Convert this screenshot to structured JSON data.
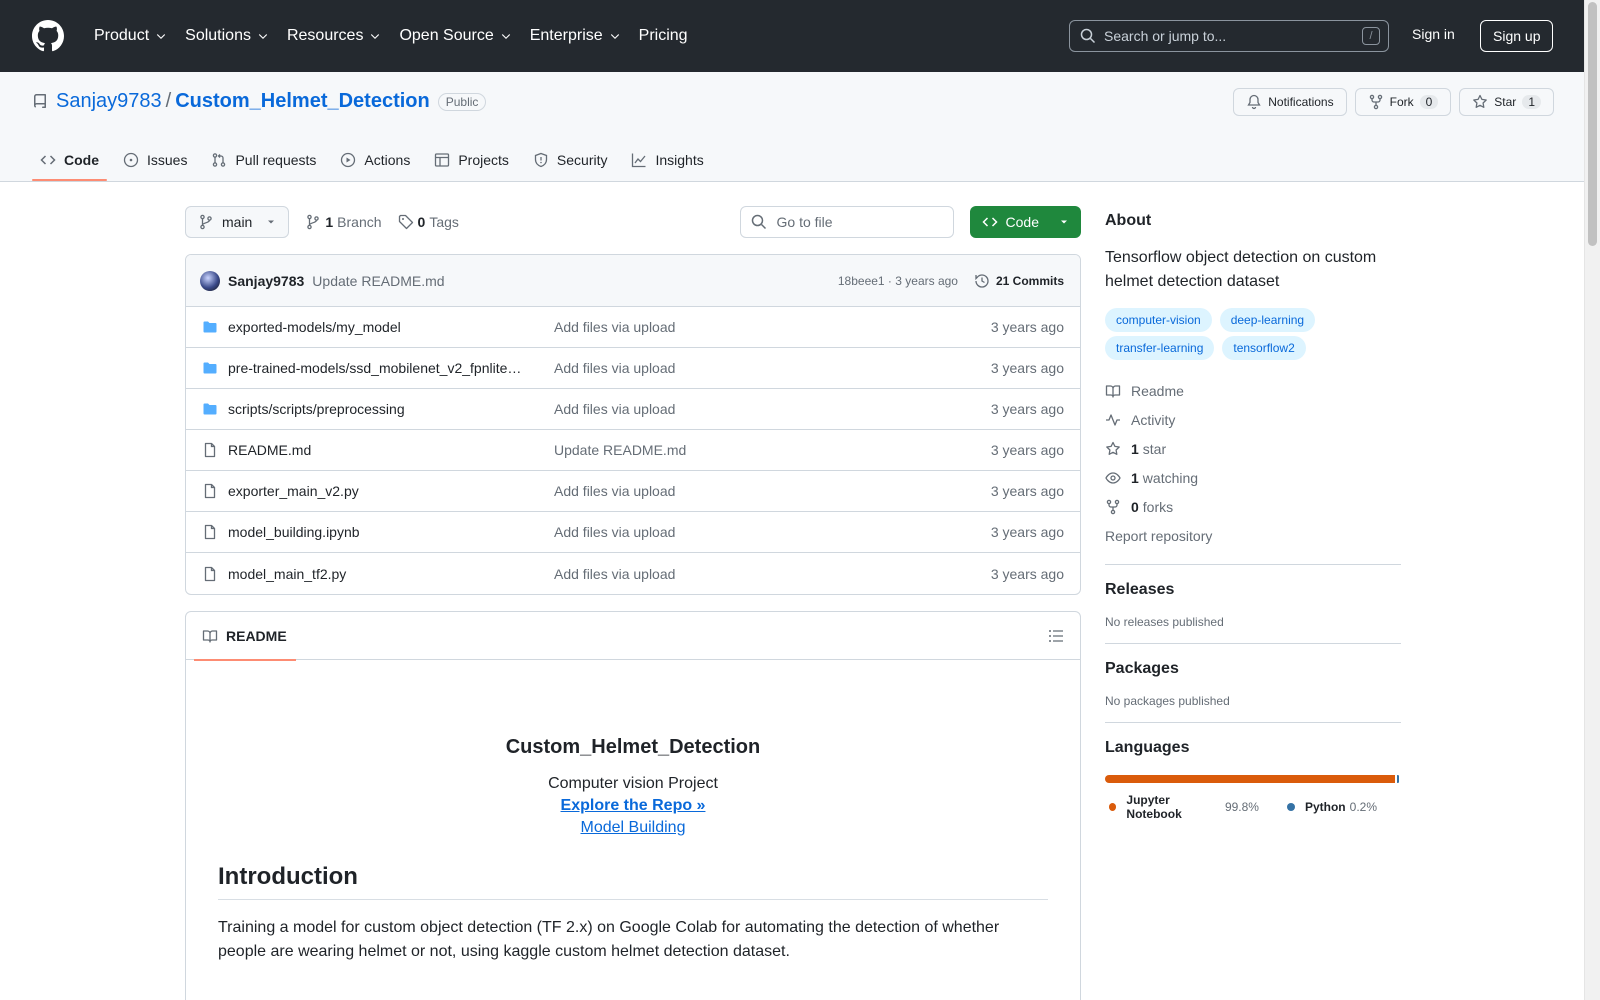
{
  "header": {
    "nav": [
      {
        "label": "Product",
        "dropdown": true
      },
      {
        "label": "Solutions",
        "dropdown": true
      },
      {
        "label": "Resources",
        "dropdown": true
      },
      {
        "label": "Open Source",
        "dropdown": true
      },
      {
        "label": "Enterprise",
        "dropdown": true
      },
      {
        "label": "Pricing",
        "dropdown": false
      }
    ],
    "search_placeholder": "Search or jump to...",
    "search_shortcut": "/",
    "sign_in": "Sign in",
    "sign_up": "Sign up"
  },
  "repo": {
    "owner": "Sanjay9783",
    "separator": "/",
    "name": "Custom_Helmet_Detection",
    "visibility": "Public",
    "notifications_label": "Notifications",
    "fork_label": "Fork",
    "fork_count": "0",
    "star_label": "Star",
    "star_count": "1"
  },
  "tabs": [
    {
      "label": "Code",
      "icon": "code-icon",
      "active": true
    },
    {
      "label": "Issues",
      "icon": "issue-icon",
      "active": false
    },
    {
      "label": "Pull requests",
      "icon": "pull-request-icon",
      "active": false
    },
    {
      "label": "Actions",
      "icon": "play-icon",
      "active": false
    },
    {
      "label": "Projects",
      "icon": "table-icon",
      "active": false
    },
    {
      "label": "Security",
      "icon": "shield-icon",
      "active": false
    },
    {
      "label": "Insights",
      "icon": "graph-icon",
      "active": false
    }
  ],
  "toolbar": {
    "branch": "main",
    "branch_count": "1",
    "branch_label": "Branch",
    "tag_count": "0",
    "tag_label": "Tags",
    "goto_placeholder": "Go to file",
    "code_button": "Code"
  },
  "latest_commit": {
    "author": "Sanjay9783",
    "message": "Update README.md",
    "meta": "18beee1 · 3 years ago",
    "commits": "21 Commits"
  },
  "files": [
    {
      "name": "exported-models/my_model",
      "type": "folder",
      "message": "Add files via upload",
      "date": "3 years ago"
    },
    {
      "name": "pre-trained-models/ssd_mobilenet_v2_fpnlite…",
      "type": "folder",
      "message": "Add files via upload",
      "date": "3 years ago"
    },
    {
      "name": "scripts/scripts/preprocessing",
      "type": "folder",
      "message": "Add files via upload",
      "date": "3 years ago"
    },
    {
      "name": "README.md",
      "type": "file",
      "message": "Update README.md",
      "date": "3 years ago"
    },
    {
      "name": "exporter_main_v2.py",
      "type": "file",
      "message": "Add files via upload",
      "date": "3 years ago"
    },
    {
      "name": "model_building.ipynb",
      "type": "file",
      "message": "Add files via upload",
      "date": "3 years ago"
    },
    {
      "name": "model_main_tf2.py",
      "type": "file",
      "message": "Add files via upload",
      "date": "3 years ago"
    }
  ],
  "readme": {
    "tab_label": "README",
    "title": "Custom_Helmet_Detection",
    "subtitle": "Computer vision Project",
    "link_explore": "Explore the Repo »",
    "link_model": "Model Building",
    "h_intro": "Introduction",
    "intro_text": "Training a model for custom object detection (TF 2.x) on Google Colab for automating the detection of whether people are wearing helmet or not, using kaggle custom helmet detection dataset."
  },
  "about": {
    "heading": "About",
    "description": "Tensorflow object detection on custom helmet detection dataset",
    "topics": [
      "computer-vision",
      "deep-learning",
      "transfer-learning",
      "tensorflow2"
    ],
    "readme": "Readme",
    "activity": "Activity",
    "stars_count": "1",
    "stars_label": "star",
    "watching_count": "1",
    "watching_label": "watching",
    "forks_count": "0",
    "forks_label": "forks",
    "report": "Report repository"
  },
  "releases": {
    "heading": "Releases",
    "text": "No releases published"
  },
  "packages": {
    "heading": "Packages",
    "text": "No packages published"
  },
  "languages": {
    "heading": "Languages",
    "items": [
      {
        "name": "Jupyter Notebook",
        "percent": "99.8%",
        "color": "#DA5B0B",
        "value": 99.8
      },
      {
        "name": "Python",
        "percent": "0.2%",
        "color": "#3572A5",
        "value": 0.2
      }
    ]
  },
  "colors": {
    "header_bg": "#24292f",
    "accent": "#0969da",
    "green": "#1f883d",
    "tab_underline": "#fd8c73"
  }
}
